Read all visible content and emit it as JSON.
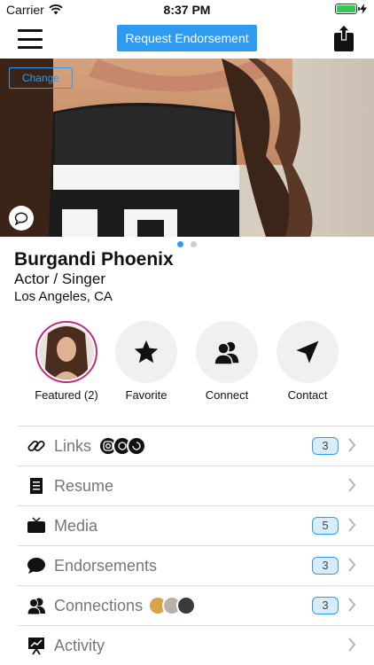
{
  "status": {
    "carrier": "Carrier",
    "time": "8:37 PM",
    "battery_level": 1.0
  },
  "nav": {
    "request_label": "Request Endorsement"
  },
  "photo": {
    "change_label": "Change",
    "pages": 2,
    "active_page": 1
  },
  "profile": {
    "name": "Burgandi Phoenix",
    "role": "Actor / Singer",
    "location": "Los Angeles, CA"
  },
  "actions": [
    {
      "label": "Featured (2)",
      "icon": "avatar"
    },
    {
      "label": "Favorite",
      "icon": "star-icon"
    },
    {
      "label": "Connect",
      "icon": "people-icon"
    },
    {
      "label": "Contact",
      "icon": "send-icon"
    }
  ],
  "list": [
    {
      "label": "Links",
      "icon": "link-icon",
      "badge": "3"
    },
    {
      "label": "Resume",
      "icon": "document-icon",
      "badge": ""
    },
    {
      "label": "Media",
      "icon": "tv-icon",
      "badge": "5"
    },
    {
      "label": "Endorsements",
      "icon": "speech-bubble-icon",
      "badge": "3"
    },
    {
      "label": "Connections",
      "icon": "people-icon",
      "badge": "3"
    },
    {
      "label": "Activity",
      "icon": "presentation-icon",
      "badge": ""
    }
  ],
  "colors": {
    "accent": "#2e9bf0",
    "featured_ring": "#c22b7d",
    "battery": "#35c759"
  }
}
